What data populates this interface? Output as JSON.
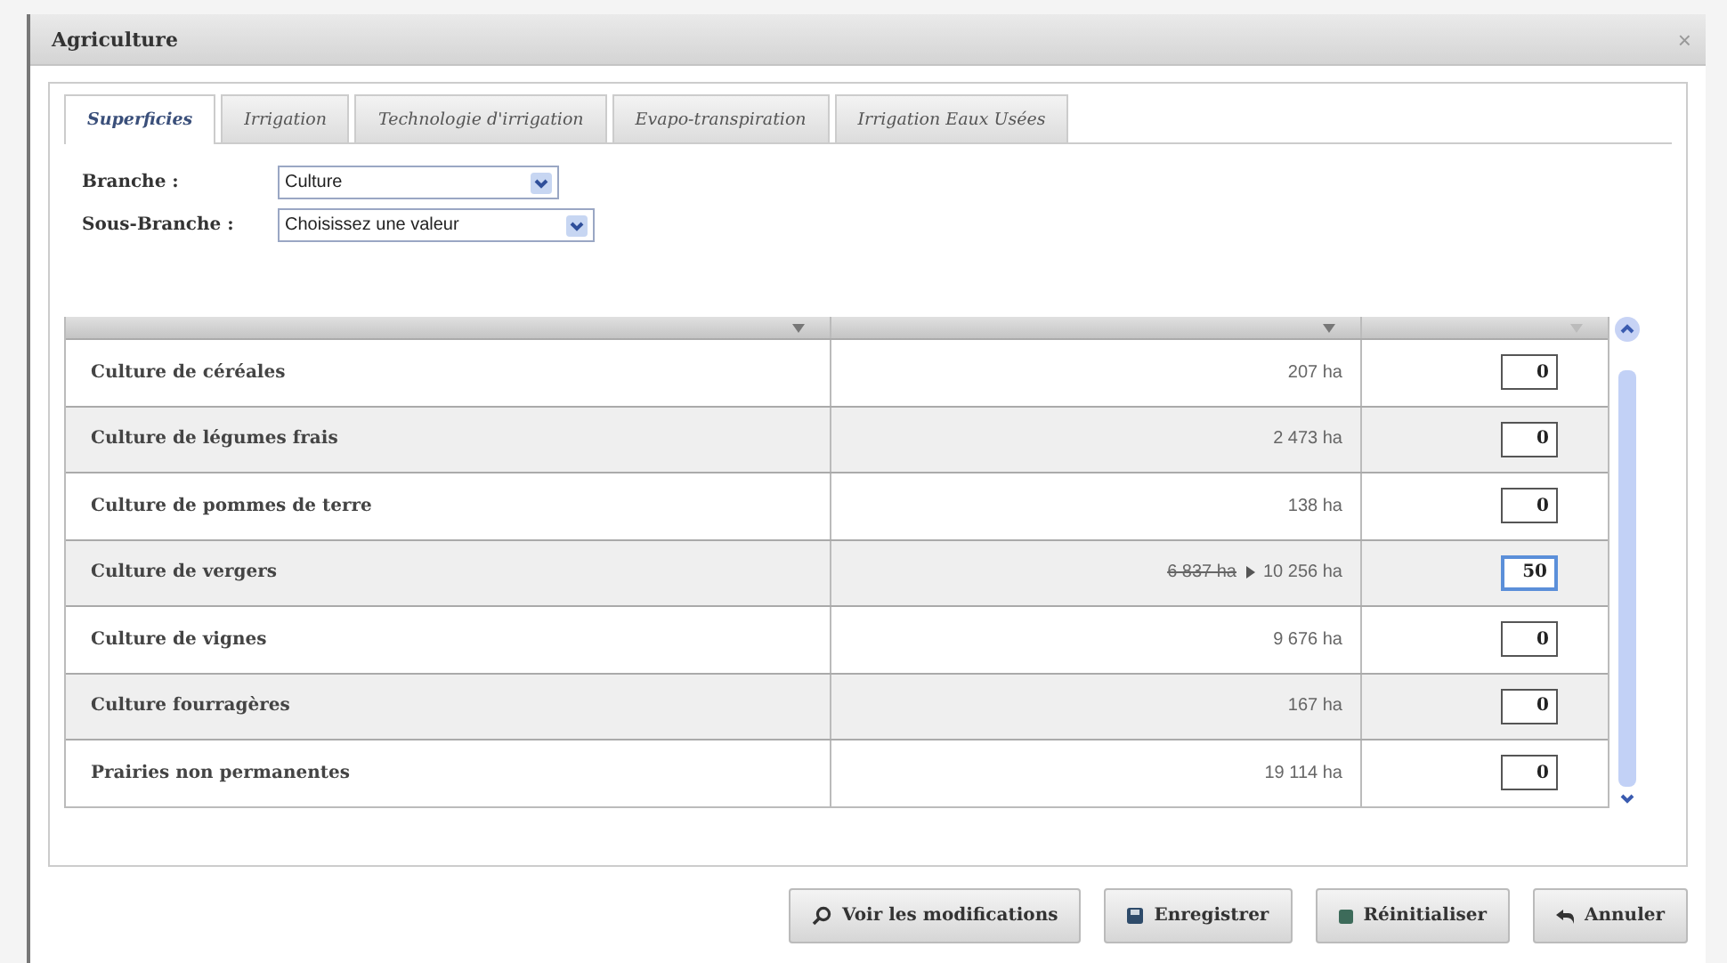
{
  "window": {
    "title": "Agriculture",
    "close": "×"
  },
  "tabs": [
    {
      "label": "Superficies",
      "selected": true
    },
    {
      "label": "Irrigation",
      "selected": false
    },
    {
      "label": "Technologie d'irrigation",
      "selected": false
    },
    {
      "label": "Evapo-transpiration",
      "selected": false
    },
    {
      "label": "Irrigation Eaux Usées",
      "selected": false
    }
  ],
  "filters": [
    {
      "label": "Branche :",
      "value": "Culture"
    },
    {
      "label": "Sous-Branche :",
      "value": "Choisissez une valeur"
    }
  ],
  "table": {
    "rows": [
      {
        "name": "Culture de céréales",
        "kind": "plain",
        "area": "207 ha",
        "variation": "0",
        "focused": false
      },
      {
        "name": "Culture de légumes frais",
        "kind": "plain",
        "area": "2 473 ha",
        "variation": "0",
        "focused": false
      },
      {
        "name": "Culture de pommes de terre",
        "kind": "plain",
        "area": "138 ha",
        "variation": "0",
        "focused": false
      },
      {
        "name": "Culture de vergers",
        "kind": "changed",
        "area_old": "6 837 ha",
        "area": "10 256 ha",
        "variation": "50",
        "focused": true
      },
      {
        "name": "Culture de vignes",
        "kind": "plain",
        "area": "9 676 ha",
        "variation": "0",
        "focused": false
      },
      {
        "name": "Culture fourragères",
        "kind": "plain",
        "area": "167 ha",
        "variation": "0",
        "focused": false
      },
      {
        "name": "Prairies non permanentes",
        "kind": "plain",
        "area": "19 114 ha",
        "variation": "0",
        "focused": false
      }
    ]
  },
  "buttons": [
    "Voir les modifications",
    "Enregistrer",
    "Réinitialiser",
    "Annuler"
  ]
}
